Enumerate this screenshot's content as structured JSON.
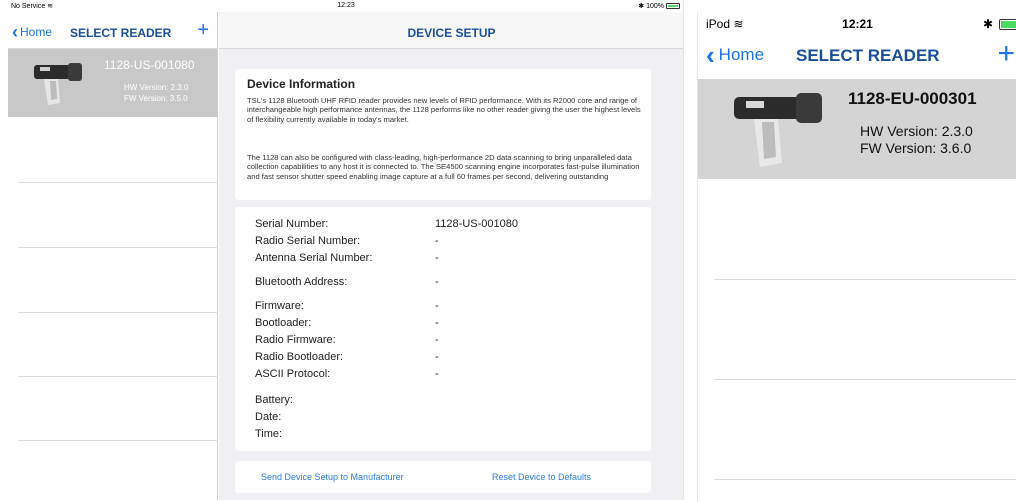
{
  "ipad": {
    "status": {
      "carrier": "No Service",
      "time": "12:23",
      "battery": "100%"
    },
    "master": {
      "back_label": "Home",
      "title": "SELECT READER",
      "add_glyph": "+",
      "reader": {
        "id": "1128-US-001080",
        "hw": "HW Version: 2.3.0",
        "fw": "FW Version: 3.5.0"
      }
    },
    "detail": {
      "title": "DEVICE SETUP",
      "info_heading": "Device Information",
      "info_p1": "TSL's 1128 Bluetooth UHF RFID reader provides new levels of RFID performance.  With its R2000 core and range of interchangeable high performance antennas, the 1128 performs like no other reader giving the user the highest levels of flexibility currently available in today's market.",
      "info_p2": "The 1128 can also be configured with class-leading, high-performance 2D data scanning to bring unparalleled data collection capabilities to any host it is connected to. The SE4500 scanning engine incorporates fast-pulse illumination and fast sensor shutter speed enabling image capture at a full 60 frames per second, delivering outstanding",
      "properties": [
        {
          "label": "Serial Number:",
          "value": "1128-US-001080"
        },
        {
          "label": "Radio Serial Number:",
          "value": "-"
        },
        {
          "label": "Antenna Serial Number:",
          "value": "-"
        },
        {
          "label": "Bluetooth Address:",
          "value": "-"
        },
        {
          "label": "Firmware:",
          "value": "-"
        },
        {
          "label": "Bootloader:",
          "value": "-"
        },
        {
          "label": "Radio Firmware:",
          "value": "-"
        },
        {
          "label": "Radio Bootloader:",
          "value": "-"
        },
        {
          "label": "ASCII Protocol:",
          "value": "-"
        },
        {
          "label": "Battery:",
          "value": ""
        },
        {
          "label": "Date:",
          "value": ""
        },
        {
          "label": "Time:",
          "value": ""
        }
      ],
      "send_label": "Send Device Setup to Manufacturer",
      "reset_label": "Reset Device to Defaults"
    }
  },
  "ipod": {
    "status": {
      "device": "iPod",
      "time": "12:21"
    },
    "back_label": "Home",
    "title": "SELECT READER",
    "add_glyph": "+",
    "reader": {
      "id": "1128-EU-000301",
      "hw": "HW Version: 2.3.0",
      "fw": "FW Version: 3.6.0"
    }
  },
  "colors": {
    "accent": "#1a73e8",
    "title_blue": "#1a4f9c",
    "selected_row_ipad": "#c8c8c8",
    "selected_row_ipod": "#d4d4d4",
    "battery": "#4cd964"
  }
}
